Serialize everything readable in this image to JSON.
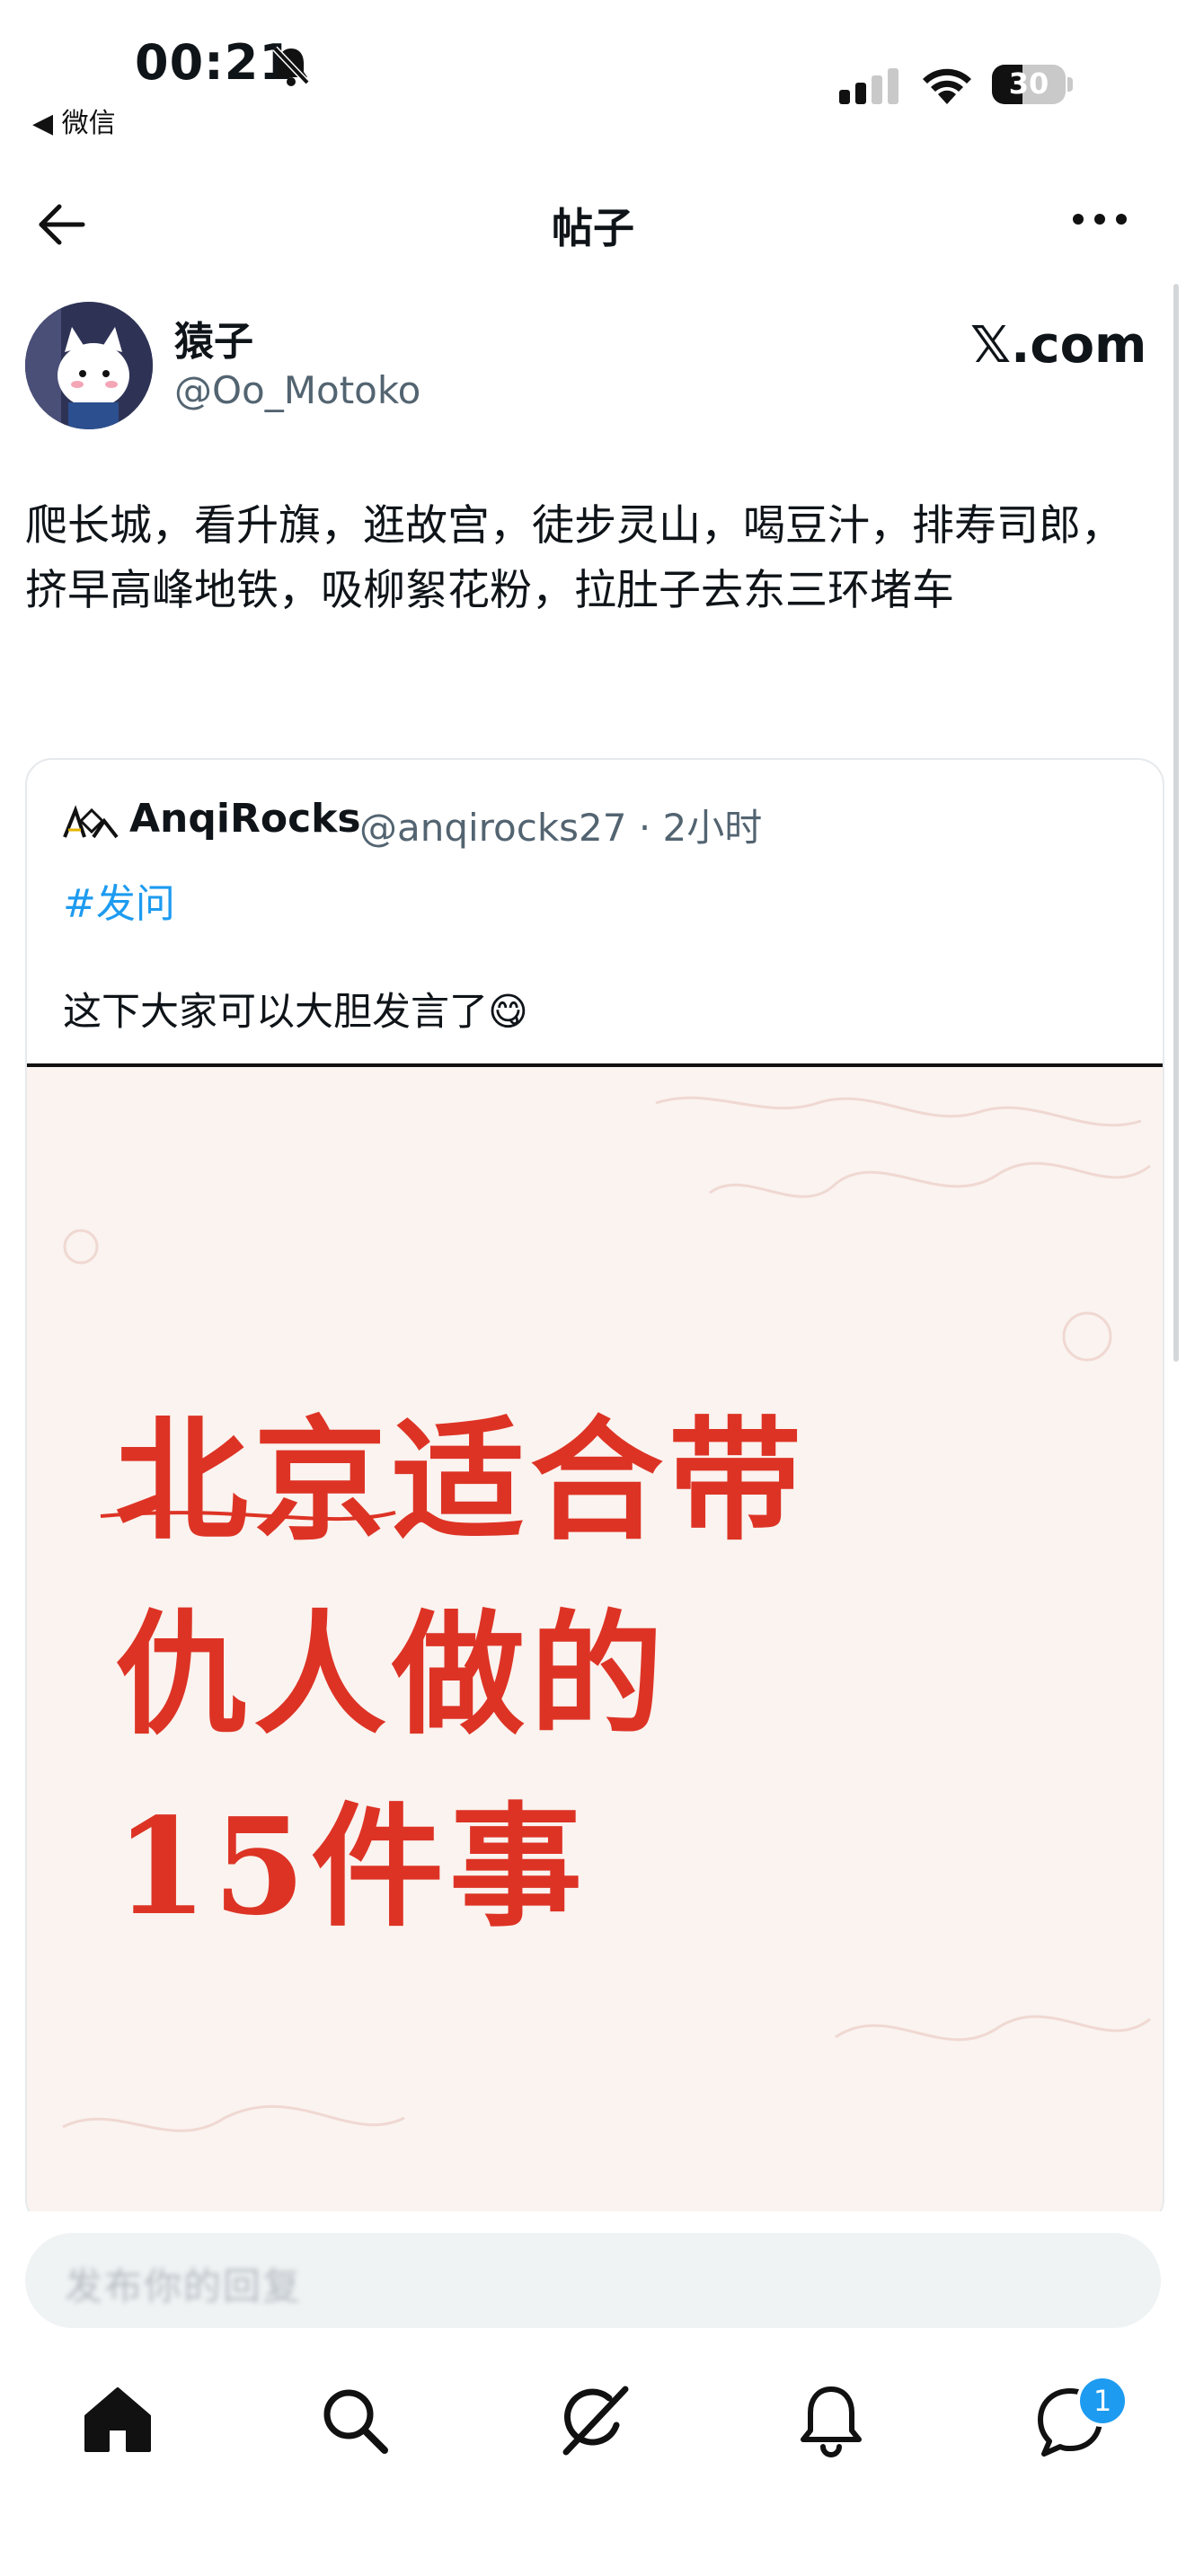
{
  "status_bar": {
    "time": "00:21",
    "back_app": "◀ 微信",
    "battery": "30"
  },
  "nav": {
    "title": "帖子"
  },
  "post": {
    "author_name": "猿子",
    "author_handle": "@Oo_Motoko",
    "source": "𝕏.com",
    "text": "爬长城，看升旗，逛故宫，徒步灵山，喝豆汁，排寿司郎，挤早高峰地铁，吸柳絮花粉，拉肚子去东三环堵车"
  },
  "quote": {
    "author_name": "AnqiRocks",
    "meta": "@anqirocks27 · 2小时",
    "hashtag": "#发问",
    "text": "这下大家可以大胆发言了😋",
    "image_lines": [
      "北京适合带",
      "仇人做的",
      "15件事"
    ]
  },
  "reply": {
    "placeholder": "发布你的回复"
  },
  "tabbar": {
    "items": [
      "home-icon",
      "search-icon",
      "grok-icon",
      "notifications-icon",
      "messages-icon"
    ],
    "messages_badge": "1"
  },
  "colors": {
    "accent": "#1d9bf0",
    "poster_red": "#dd3325"
  }
}
